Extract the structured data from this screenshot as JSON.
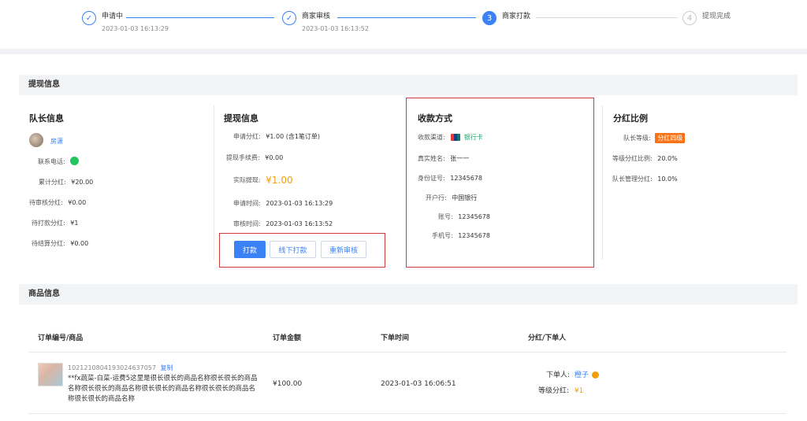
{
  "steps": [
    {
      "title": "申请中",
      "time": "2023-01-03 16:13:29",
      "state": "done"
    },
    {
      "title": "商家审核",
      "time": "2023-01-03 16:13:52",
      "state": "done"
    },
    {
      "title": "商家打款",
      "number": "3",
      "state": "active"
    },
    {
      "title": "提现完成",
      "number": "4",
      "state": "pending"
    }
  ],
  "withdraw_section": {
    "title": "提现信息"
  },
  "captain": {
    "title": "队长信息",
    "name": "房潇",
    "phone_label": "联系电话:",
    "accum_label": "累计分红:",
    "accum_value": "¥20.00",
    "pending_review_label": "待审核分红:",
    "pending_review_value": "¥0.00",
    "pending_pay_label": "待打款分红:",
    "pending_pay_value": "¥1",
    "pending_settle_label": "待结算分红:",
    "pending_settle_value": "¥0.00"
  },
  "withdraw": {
    "title": "提现信息",
    "apply_label": "申请分红:",
    "apply_value": "¥1.00 (含1笔订单)",
    "fee_label": "提现手续费:",
    "fee_value": "¥0.00",
    "actual_label": "实际提现:",
    "actual_value": "¥1.00",
    "apply_time_label": "申请时间:",
    "apply_time_value": "2023-01-03 16:13:29",
    "review_time_label": "审核时间:",
    "review_time_value": "2023-01-03 16:13:52",
    "btn_pay": "打款",
    "btn_offline": "线下打款",
    "btn_rereview": "重新审核"
  },
  "payment": {
    "title": "收款方式",
    "channel_label": "收款渠道:",
    "channel_value": "银行卡",
    "name_label": "真实姓名:",
    "name_value": "张一一",
    "id_label": "身份证号:",
    "id_value": "12345678",
    "bank_label": "开户行:",
    "bank_value": "中国银行",
    "account_label": "账号:",
    "account_value": "12345678",
    "mobile_label": "手机号:",
    "mobile_value": "12345678"
  },
  "ratio": {
    "title": "分红比例",
    "level_label": "队长等级:",
    "level_value": "分红四级",
    "level_ratio_label": "等级分红比例:",
    "level_ratio_value": "20.0%",
    "mgmt_label": "队长管理分红:",
    "mgmt_value": "10.0%"
  },
  "goods_section": {
    "title": "商品信息"
  },
  "table": {
    "headers": [
      "订单编号/商品",
      "订单金额",
      "下单时间",
      "分红/下单人"
    ],
    "row": {
      "order_no": "1021210804193024637057",
      "copy": "复制",
      "product": "**fx蔬菜-白菜-运费5这里是很长很长的商品名称很长很长的商品名称很长很长的商品名称很长很长的商品名称很长很长的商品名称很长很长的商品名称",
      "amount": "¥100.00",
      "time": "2023-01-03 16:06:51",
      "buyer_label": "下单人:",
      "buyer_name": "橙子",
      "level_label": "等级分红:",
      "level_value": "¥1"
    }
  },
  "colors": {
    "primary": "#3b82f6",
    "accent_orange": "#f59e0b",
    "wechat_green": "#22c55e",
    "highlight_red": "#d33b3b"
  }
}
